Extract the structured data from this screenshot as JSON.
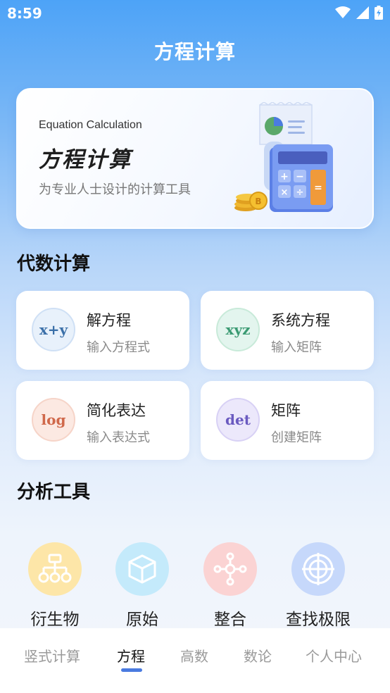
{
  "status": {
    "time": "8:59"
  },
  "header": {
    "title": "方程计算"
  },
  "banner": {
    "title_en": "Equation Calculation",
    "title_cn": "方程计算",
    "subtitle": "为专业人士设计的计算工具"
  },
  "algebra": {
    "title": "代数计算",
    "cards": [
      {
        "title": "解方程",
        "subtitle": "输入方程式",
        "icon_text": "x+y",
        "icon": "x-plus-y-icon",
        "color": "#3a6fa8",
        "bg": "#e8f1fb"
      },
      {
        "title": "系统方程",
        "subtitle": "输入矩阵",
        "icon_text": "xyz",
        "icon": "xyz-icon",
        "color": "#3a9a72",
        "bg": "#e3f5ee"
      },
      {
        "title": "简化表达",
        "subtitle": "输入表达式",
        "icon_text": "log",
        "icon": "log-icon",
        "color": "#d0684a",
        "bg": "#fce9e2"
      },
      {
        "title": "矩阵",
        "subtitle": "创建矩阵",
        "icon_text": "det",
        "icon": "det-icon",
        "color": "#6a5ac0",
        "bg": "#ece8fb"
      }
    ]
  },
  "analysis": {
    "title": "分析工具",
    "tools": [
      {
        "label": "衍生物",
        "icon": "hierarchy-icon",
        "bg": "#fde9b0",
        "color": "#f0a020"
      },
      {
        "label": "原始",
        "icon": "cube-icon",
        "bg": "#c9ecfb",
        "color": "#40b4e8"
      },
      {
        "label": "整合",
        "icon": "network-icon",
        "bg": "#fcd6d6",
        "color": "#ee7a7a"
      },
      {
        "label": "查找极限",
        "icon": "target-icon",
        "bg": "#c9dbfb",
        "color": "#4a7be0"
      }
    ]
  },
  "tabs": [
    {
      "label": "竖式计算",
      "active": false
    },
    {
      "label": "方程",
      "active": true
    },
    {
      "label": "高数",
      "active": false
    },
    {
      "label": "数论",
      "active": false
    },
    {
      "label": "个人中心",
      "active": false
    }
  ],
  "colors": {
    "accent": "#4a7be0",
    "header_top": "#4da3f7"
  }
}
